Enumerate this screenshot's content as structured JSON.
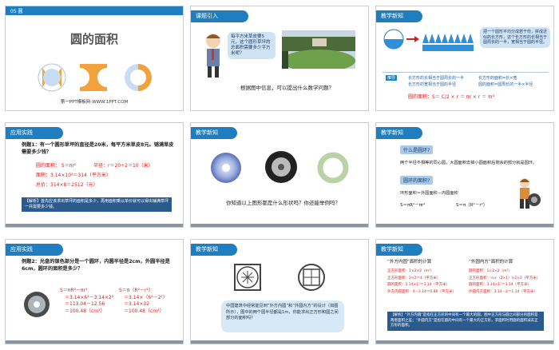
{
  "slides": [
    {
      "num": "1",
      "tag": "05 圆",
      "title": "圆的面积",
      "footer": "第一PPT模板网-WWW.1PPT.COM"
    },
    {
      "num": "2",
      "header": "课题引入",
      "bubble": "每平方米草皮要5元，这个圆形草坪的总面积需要多少平方米呢？",
      "question": "根据图中信息，可以提出什么数学问题？"
    },
    {
      "num": "3",
      "header": "教学新知",
      "bubble": "把一个圆形平均分成若干份，拼成近似的长方形，这个长方形的长相当于圆周长的一半，宽相当于圆的半径。",
      "bar_label": "推导",
      "l1a": "长方形的长相当于圆周长的一半",
      "l1b": "长方形的宽相当于圆的半径",
      "l2a": "长方形的面积=长×宽",
      "l2b": "圆的面积=圆周长的一半×半径",
      "formula": "圆的面积：S＝ C/2 × r ＝ πr × r ＝ πr²"
    },
    {
      "num": "4",
      "header": "应用实践",
      "ex": "例题1：有一个圆形草坪的直径是20米，每平方米草皮8元。铺满草皮需要多少钱？",
      "f1": "圆的面积： S＝πr²",
      "f1b": "半径：r＝20÷2＝10（米）",
      "f2": "面积：3.14×10²＝314（平方米）",
      "f3": "总价：314×8＝2512（元）",
      "note": "【解析】首先应该求出草坪的面积是多少，再用面积乘以单价就可以得出铺满草坪一共需要多少钱。"
    },
    {
      "num": "5",
      "header": "教学新知",
      "question": "你知道以上图形都是什么形状吗？你还能举例吗？"
    },
    {
      "num": "6",
      "header": "教学新知",
      "t1": "什么是圆环?",
      "d1": "两个半径不相等的同心圆，大圆面积去掉小圆面积后剩余的部分就是圆环。",
      "t2": "圆环的面积?",
      "d2": "环形面积＝外圆面积－内圆面积",
      "f1": "S＝πR²－πr²",
      "f2": "S＝π（R²－r²）"
    },
    {
      "num": "7",
      "header": "应用实践",
      "ex": "例题2：光盘的银色部分是一个圆环，内圆半径是2cm，外圆半径是6cm，圆环的面积是多少？",
      "c1": [
        "S＝πR²－πr²",
        "＝3.14×6²－3.14×2²",
        "＝113.04－12.56",
        "＝100.48（cm²）"
      ],
      "c2": [
        "S＝π（R²－r²）",
        "＝3.14×（6²－2²）",
        "＝3.14×32",
        "＝100.48（cm²）"
      ]
    },
    {
      "num": "8",
      "header": "教学新知",
      "note": "中国建筑中经常能见到“外方内圆”和“外圆内方”的设计（如图所示），图中的两个圆半径都是1m，你能求出正方形和圆之间部分的面积吗？"
    },
    {
      "num": "9",
      "header": "教学新知",
      "h1": "“外方内圆”面积的计算",
      "h2": "“外圆内方”面积的计算",
      "a": [
        "正方形面积：1×2×2（m²）",
        "正方形面积：2×2＝4（平方米）",
        "圆的面积：3.14×1²＝3.14（平方米）",
        "外方内圆面积：4－3.14＝0.86（平方米）"
      ],
      "b": [
        "圆的面积：1×2×2（m²）",
        "正方形面积：½×（2×1）×2×2（平方米）",
        "圆的面积：3.14×1²＝3.14（平方米）",
        "外圆内方面积：3.14－2＝1.14（平方米）"
      ],
      "note": "【解析】“外方内圆”是指在正方形的中间有一个最大的圆，图中正方形与圆之间部分的面积是两者面积之差；“外圆内方”是指在圆的中间有一个最大的正方形，求面积时用圆的面积减去正方形的面积。"
    }
  ],
  "colors": {
    "primary": "#1f7ec0",
    "navy": "#2b5a8f",
    "red": "#d62020",
    "orange": "#f2a23a"
  }
}
